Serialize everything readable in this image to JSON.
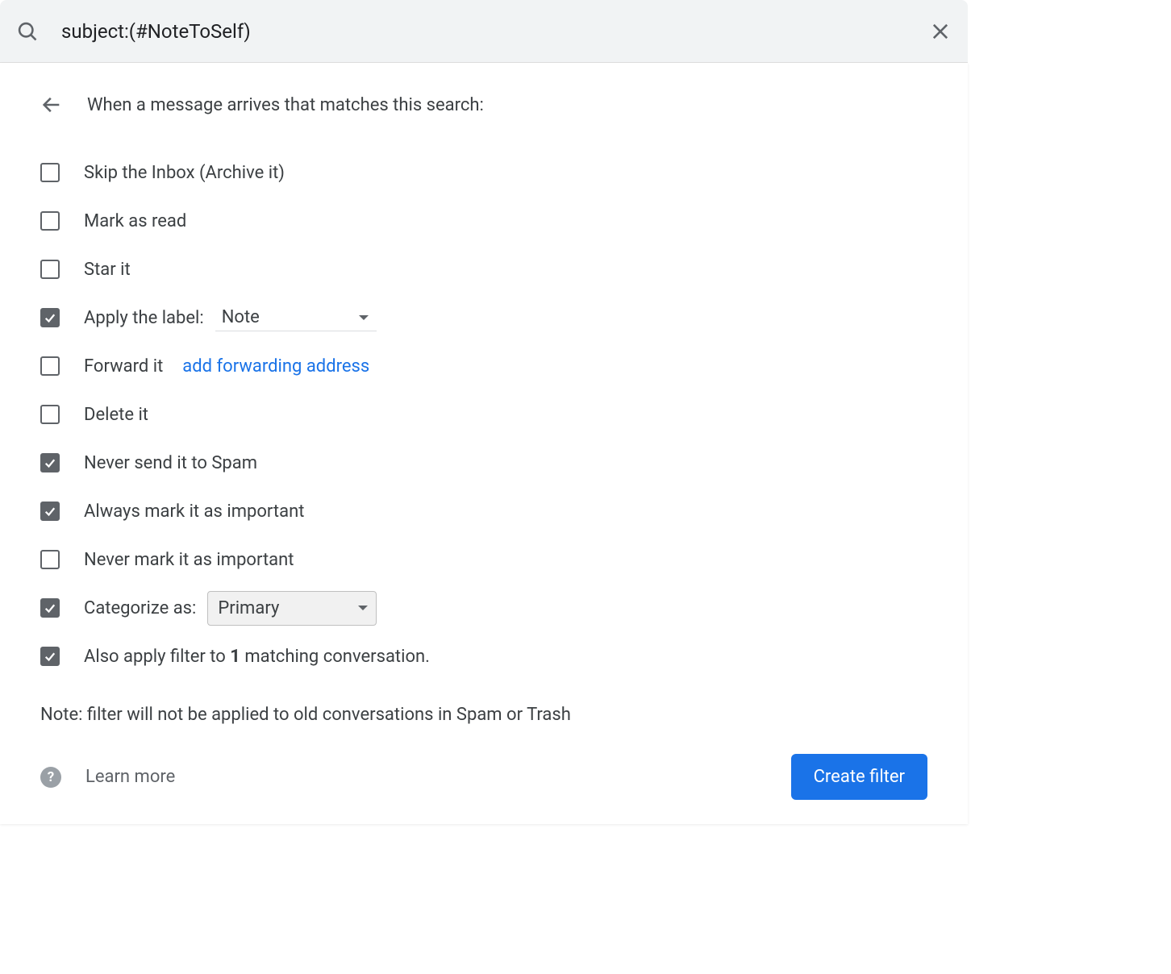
{
  "search": {
    "value": "subject:(#NoteToSelf)"
  },
  "header": {
    "title": "When a message arrives that matches this search:"
  },
  "options": {
    "skip_inbox": {
      "label": "Skip the Inbox (Archive it)",
      "checked": false
    },
    "mark_read": {
      "label": "Mark as read",
      "checked": false
    },
    "star": {
      "label": "Star it",
      "checked": false
    },
    "apply_label": {
      "label": "Apply the label:",
      "checked": true,
      "value": "Note"
    },
    "forward": {
      "label": "Forward it",
      "checked": false,
      "link": "add forwarding address"
    },
    "delete": {
      "label": "Delete it",
      "checked": false
    },
    "never_spam": {
      "label": "Never send it to Spam",
      "checked": true
    },
    "always_important": {
      "label": "Always mark it as important",
      "checked": true
    },
    "never_important": {
      "label": "Never mark it as important",
      "checked": false
    },
    "categorize": {
      "label": "Categorize as:",
      "checked": true,
      "value": "Primary"
    },
    "also_apply": {
      "prefix": "Also apply filter to ",
      "count": "1",
      "suffix": " matching conversation.",
      "checked": true
    }
  },
  "note": "Note: filter will not be applied to old conversations in Spam or Trash",
  "footer": {
    "learn_more": "Learn more",
    "create": "Create filter"
  }
}
